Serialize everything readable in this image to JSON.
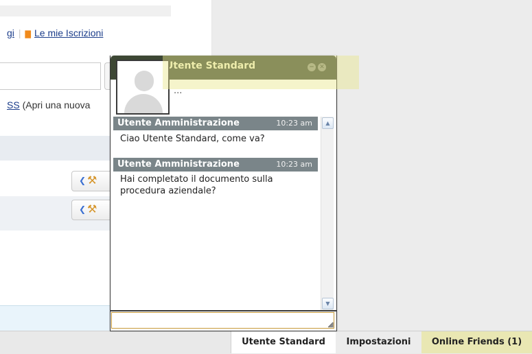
{
  "page": {
    "links": {
      "partial_link": "gi",
      "subscriptions_link": "Le mie Iscrizioni"
    },
    "rss_line": {
      "link": "SS",
      "text": " (Apri una nuova"
    }
  },
  "chat": {
    "title": "Utente Standard",
    "status": "...",
    "messages": [
      {
        "sender": "Utente Amministrazione",
        "time": "10:23 am",
        "text": "Ciao Utente Standard, come va?"
      },
      {
        "sender": "Utente Amministrazione",
        "time": "10:23 am",
        "text": "Hai completato il documento sulla procedura aziendale?"
      }
    ],
    "input_value": ""
  },
  "bottom_bar": {
    "tabs": [
      {
        "label": "Utente Standard"
      },
      {
        "label": "Impostazioni"
      },
      {
        "label": "Online Friends (1)"
      }
    ]
  },
  "colors": {
    "chat_header": "#3d4734",
    "chat_title": "#f3f3c6",
    "message_header": "#7a8589",
    "highlight": "#e9e78c",
    "link": "#1a3c8a",
    "rss_icon": "#f08a1c"
  },
  "icons": [
    "rss-icon",
    "minimize-icon",
    "close-icon",
    "avatar-icon",
    "scroll-up-icon",
    "scroll-down-icon",
    "arrow-left-icon",
    "wrench-icon",
    "resize-grip-icon"
  ]
}
